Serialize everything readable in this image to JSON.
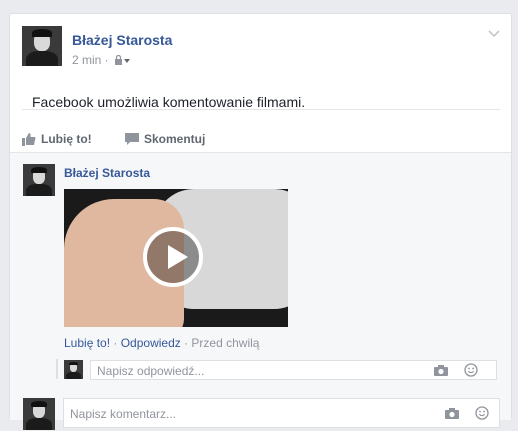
{
  "post": {
    "author": "Błażej Starosta",
    "time": "2 min ·",
    "text": "Facebook umożliwia komentowanie filmami.",
    "actions": {
      "like": "Lubię to!",
      "comment": "Skomentuj"
    }
  },
  "comment": {
    "author": "Błażej Starosta",
    "like": "Lubię to!",
    "sep1": " · ",
    "reply": "Odpowiedz",
    "time": " · Przed chwilą"
  },
  "reply_input": {
    "placeholder": "Napisz odpowiedź..."
  },
  "comment_input": {
    "placeholder": "Napisz komentarz..."
  },
  "colors": {
    "link": "#365899",
    "muted": "#90949c",
    "background": "#e9ebee"
  }
}
